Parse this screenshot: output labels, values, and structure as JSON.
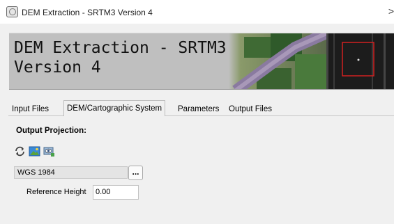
{
  "window": {
    "title": "DEM Extraction - SRTM3 Version 4",
    "close_glyph": ">"
  },
  "banner": {
    "title": "DEM Extraction - SRTM3\nVersion 4"
  },
  "tabs": [
    {
      "label": "Input Files",
      "active": false
    },
    {
      "label": "DEM/Cartographic System",
      "active": true
    },
    {
      "label": "Parameters",
      "active": false
    },
    {
      "label": "Output Files",
      "active": false
    }
  ],
  "output_projection": {
    "label": "Output Projection:",
    "value": "WGS 1984",
    "browse_label": "...",
    "toolbar_icons": [
      "refresh-icon",
      "image-icon",
      "view-icon"
    ]
  },
  "reference_height": {
    "label": "Reference Height",
    "value": "0.00"
  }
}
